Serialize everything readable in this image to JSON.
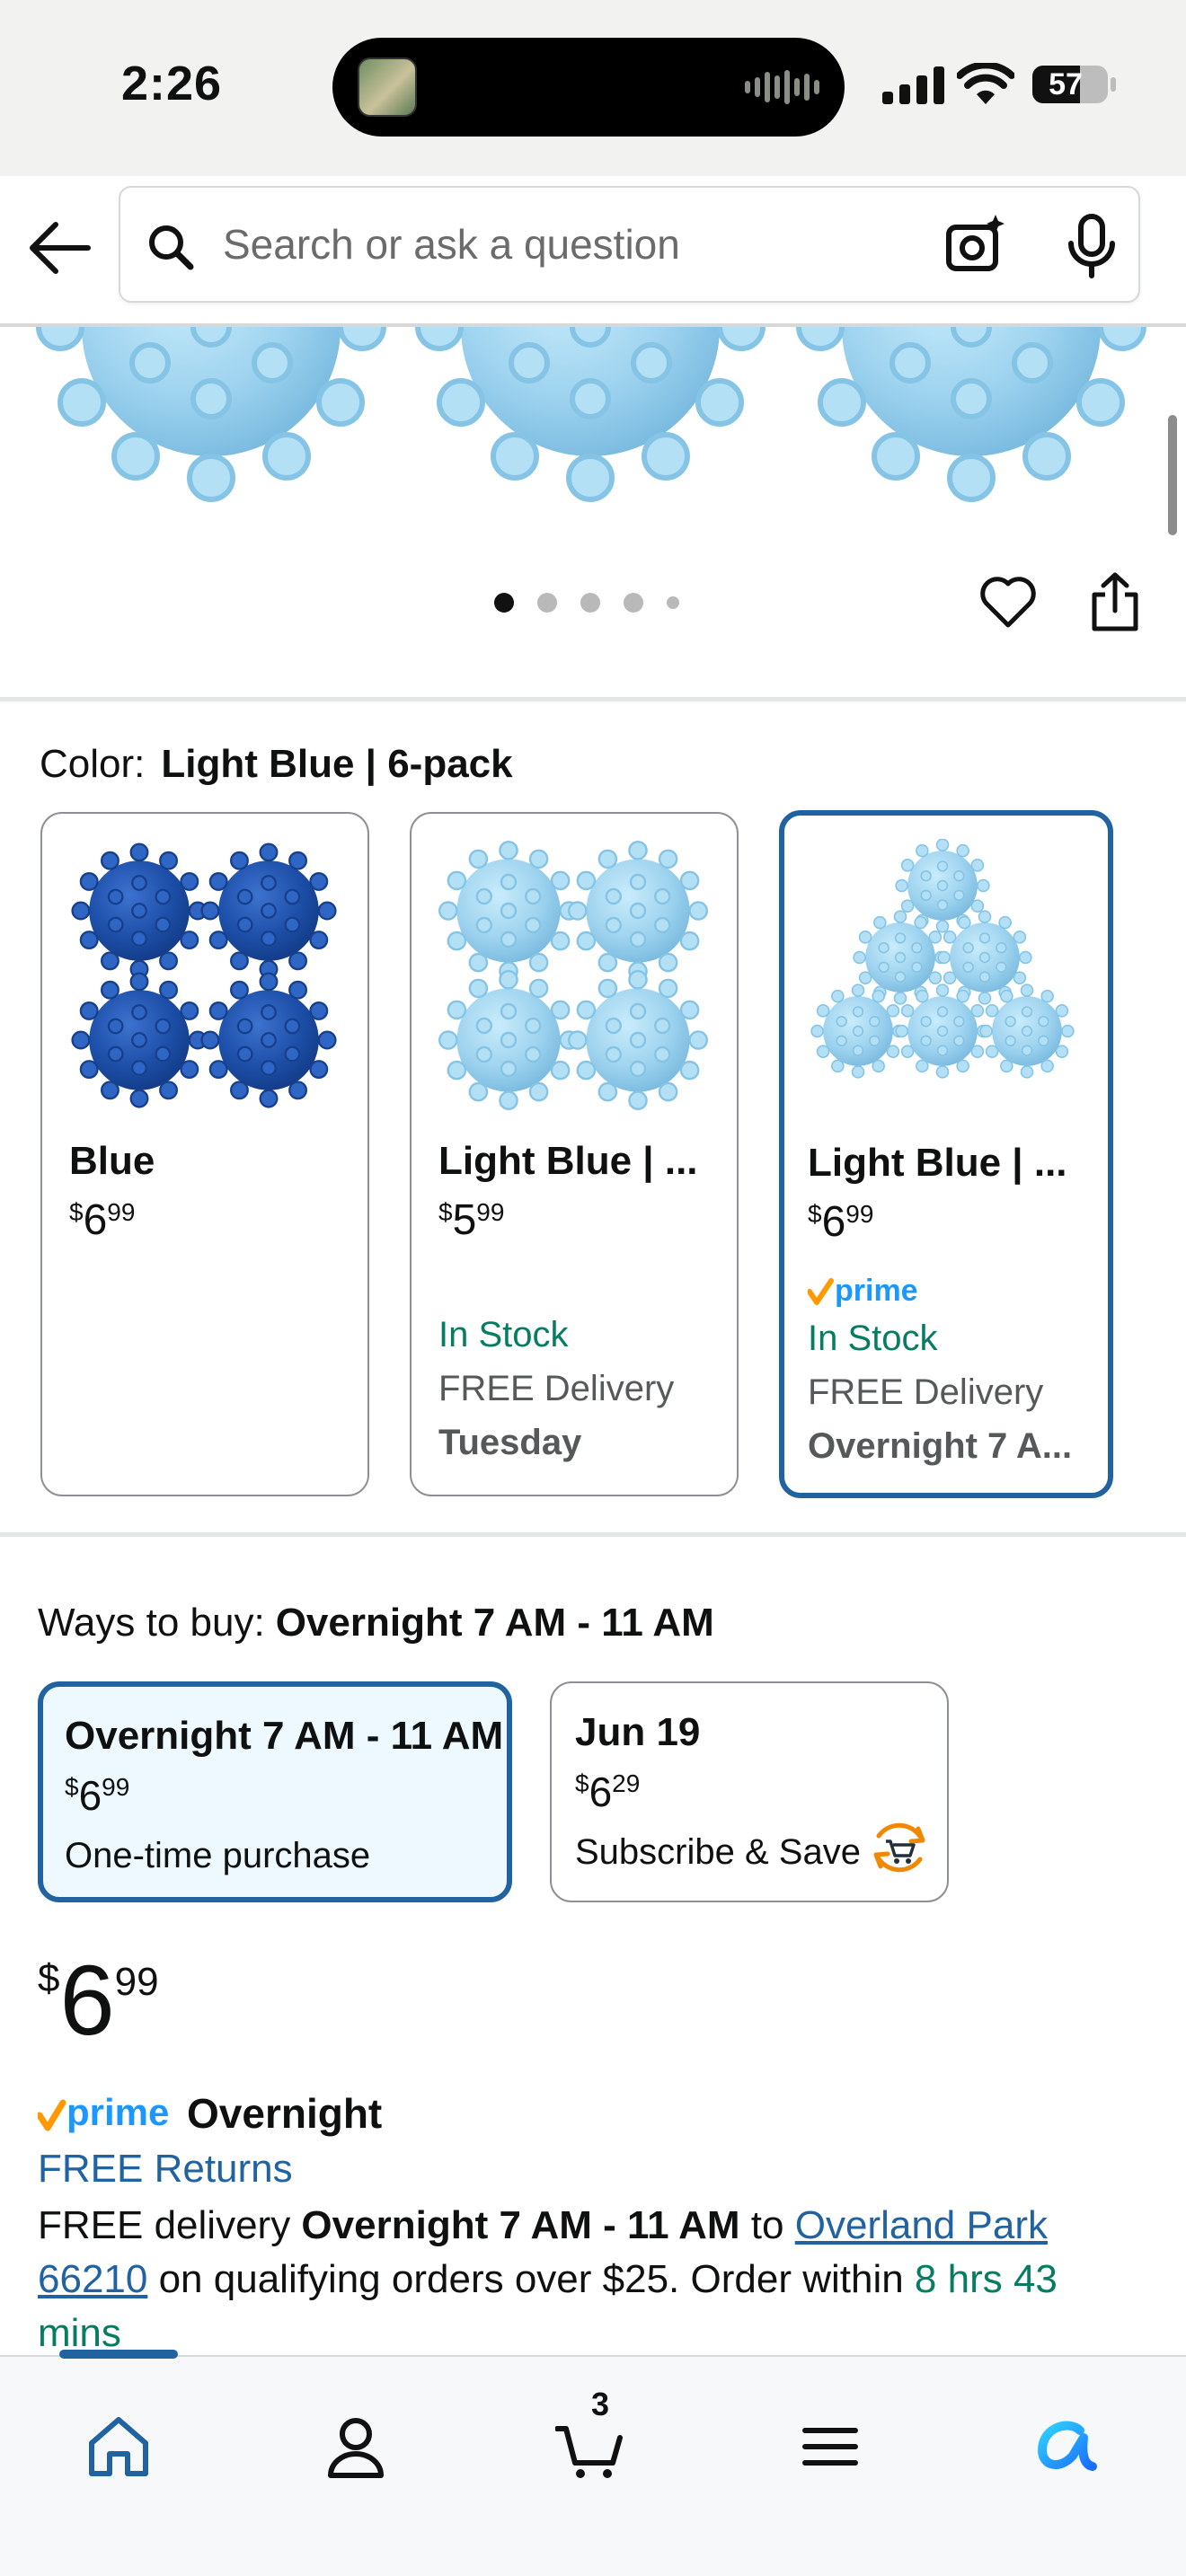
{
  "status_bar": {
    "time": "2:26",
    "battery": "57"
  },
  "search": {
    "placeholder": "Search or ask a question"
  },
  "color_section": {
    "label": "Color:",
    "selected_value": "Light Blue | 6-pack",
    "options": [
      {
        "name": "Blue",
        "price_currency": "$",
        "price_whole": "6",
        "price_fraction": "99",
        "prime": false,
        "stock": "",
        "delivery": "",
        "delivery_day": ""
      },
      {
        "name": "Light Blue | ...",
        "price_currency": "$",
        "price_whole": "5",
        "price_fraction": "99",
        "prime": false,
        "stock": "In Stock",
        "delivery": "FREE Delivery",
        "delivery_day": "Tuesday"
      },
      {
        "name": "Light Blue | ...",
        "price_currency": "$",
        "price_whole": "6",
        "price_fraction": "99",
        "prime": true,
        "stock": "In Stock",
        "delivery": "FREE Delivery",
        "delivery_day": "Overnight 7 A..."
      }
    ]
  },
  "ways_to_buy": {
    "label": "Ways to buy:",
    "selected_value": "Overnight 7 AM - 11 AM",
    "options": [
      {
        "title": "Overnight 7 AM - 11 AM",
        "price_currency": "$",
        "price_whole": "6",
        "price_fraction": "99",
        "description": "One-time purchase"
      },
      {
        "title": "Jun 19",
        "price_currency": "$",
        "price_whole": "6",
        "price_fraction": "29",
        "description": "Subscribe & Save"
      }
    ]
  },
  "price": {
    "currency": "$",
    "whole": "6",
    "fraction": "99"
  },
  "delivery": {
    "prime_label": "Overnight",
    "returns": "FREE Returns",
    "text_prefix": "FREE delivery ",
    "window": "Overnight 7 AM - 11 AM",
    "to": " to ",
    "location": "Overland Park 66210",
    "text_middle": " on qualifying orders over $25. Order within ",
    "countdown": "8 hrs 43 mins"
  },
  "bottom_nav": {
    "items": [
      "home-icon",
      "account-icon",
      "cart-icon",
      "menu-icon",
      "rufus-icon"
    ],
    "cart_count": "3"
  },
  "colors": {
    "accent": "#2162a1",
    "green": "#067d62",
    "prime_orange": "#ff9900",
    "ball_dark": "#1d4fa8",
    "ball_light": "#9ed3ef"
  }
}
